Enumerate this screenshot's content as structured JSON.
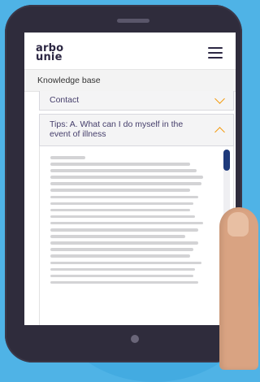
{
  "app": {
    "logo_line1": "arbo",
    "logo_line2": "unie",
    "breadcrumb": "Knowledge base"
  },
  "accordion": {
    "contact_label": "Contact",
    "tips_label": "Tips: A. What can I do myself in the event of illness",
    "contact_state": "collapsed",
    "tips_state": "expanded"
  },
  "icons": {
    "menu": "hamburger-icon",
    "collapsed": "chevron-down-icon",
    "expanded": "chevron-up-icon"
  },
  "colors": {
    "background": "#4fb3e6",
    "device": "#2f2c3c",
    "brand_text": "#2c2743",
    "accent_chevron": "#f39c12",
    "scroll_thumb": "#1e3a7b"
  }
}
